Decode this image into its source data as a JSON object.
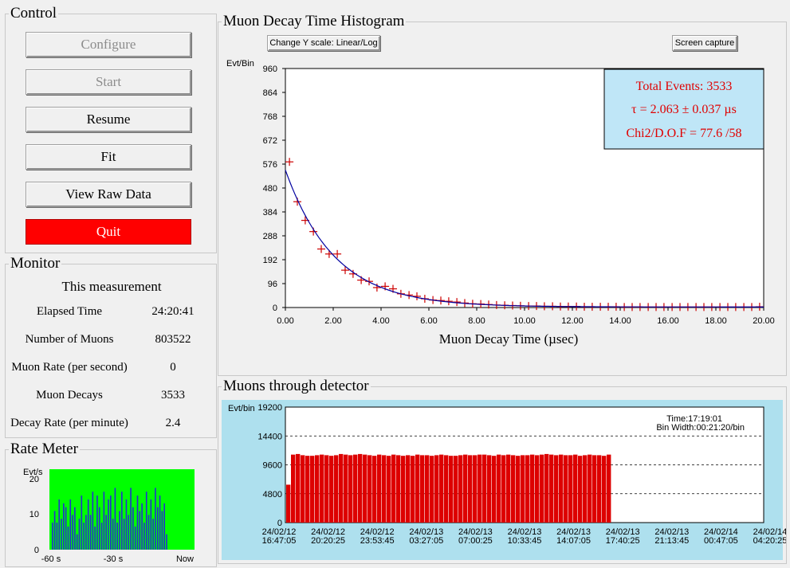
{
  "control": {
    "title": "Control",
    "buttons": {
      "configure": "Configure",
      "start": "Start",
      "resume": "Resume",
      "fit": "Fit",
      "view_raw": "View Raw Data",
      "quit": "Quit"
    },
    "quit_color": "#ff0000"
  },
  "monitor": {
    "title": "Monitor",
    "subtitle": "This measurement",
    "rows": [
      {
        "label": "Elapsed Time",
        "value": "24:20:41"
      },
      {
        "label": "Number of Muons",
        "value": "803522"
      },
      {
        "label": "Muon Rate (per second)",
        "value": "0"
      },
      {
        "label": "Muon Decays",
        "value": "3533"
      },
      {
        "label": "Decay Rate (per minute)",
        "value": "2.4"
      }
    ]
  },
  "rate_meter": {
    "title": "Rate Meter",
    "ylabel": "Evt/s",
    "yticks": [
      "20",
      "10",
      "0"
    ],
    "xticks": [
      "-60 s",
      "-30 s",
      "Now"
    ],
    "colors": {
      "background": "#00ff00",
      "bars": "#2233cc"
    }
  },
  "histogram": {
    "title": "Muon Decay Time Histogram",
    "buttons": {
      "scale": "Change Y scale: Linear/Log",
      "capture": "Screen capture"
    },
    "info": {
      "total": "Total Events: 3533",
      "tau": "τ = 2.063 ± 0.037 µs",
      "chi2": "Chi2/D.O.F = 77.6 /58"
    },
    "colors": {
      "info_bg": "#bfe6f7",
      "info_text": "#e00000",
      "points": "#cc0000",
      "fit": "#0000a0"
    }
  },
  "detector": {
    "title": "Muons through detector",
    "time": "Time:17:19:01",
    "binwidth": "Bin Width:00:21:20/bin",
    "colors": {
      "outer_bg": "#aee0ee",
      "inner_bg": "#ffffff",
      "bars": "#dd0000"
    }
  },
  "chart_data": [
    {
      "type": "scatter",
      "title": "",
      "xlabel": "Muon Decay Time (µsec)",
      "ylabel": "Evt/Bin",
      "xlim": [
        0,
        20
      ],
      "ylim": [
        0,
        960
      ],
      "xticks": [
        "0.00",
        "2.00",
        "4.00",
        "6.00",
        "8.00",
        "10.00",
        "12.00",
        "14.00",
        "16.00",
        "18.00",
        "20.00"
      ],
      "yticks": [
        "0",
        "96",
        "192",
        "288",
        "384",
        "480",
        "576",
        "672",
        "768",
        "864",
        "960"
      ],
      "grid": false,
      "x": [
        0.17,
        0.5,
        0.83,
        1.17,
        1.5,
        1.83,
        2.17,
        2.5,
        2.83,
        3.17,
        3.5,
        3.83,
        4.17,
        4.5,
        4.83,
        5.17,
        5.5,
        5.83,
        6.17,
        6.5,
        6.83,
        7.17,
        7.5,
        7.83,
        8.17,
        8.5,
        8.83,
        9.17,
        9.5,
        9.83,
        10.17,
        10.5,
        10.83,
        11.17,
        11.5,
        11.83,
        12.17,
        12.5,
        12.83,
        13.17,
        13.5,
        13.83,
        14.17,
        14.5,
        14.83,
        15.17,
        15.5,
        15.83,
        16.17,
        16.5,
        16.83,
        17.17,
        17.5,
        17.83,
        18.17,
        18.5,
        18.83,
        19.17,
        19.5,
        19.83
      ],
      "y": [
        585,
        425,
        350,
        305,
        235,
        215,
        215,
        150,
        135,
        110,
        105,
        80,
        85,
        75,
        55,
        50,
        45,
        35,
        30,
        28,
        25,
        22,
        18,
        15,
        14,
        12,
        10,
        9,
        8,
        7,
        6,
        6,
        5,
        5,
        4,
        4,
        4,
        3,
        3,
        3,
        3,
        3,
        2,
        2,
        2,
        2,
        2,
        2,
        2,
        2,
        2,
        2,
        2,
        2,
        2,
        2,
        2,
        2,
        2,
        3
      ],
      "fit": {
        "A": 550,
        "tau": 2.063
      }
    },
    {
      "type": "bar",
      "title": "",
      "ylabel": "Evt/bin",
      "ylim": [
        0,
        19200
      ],
      "yticks": [
        "0",
        "4800",
        "9600",
        "14400",
        "19200"
      ],
      "xticks": [
        [
          "24/02/12",
          "16:47:05"
        ],
        [
          "24/02/12",
          "20:20:25"
        ],
        [
          "24/02/12",
          "23:53:45"
        ],
        [
          "24/02/13",
          "03:27:05"
        ],
        [
          "24/02/13",
          "07:00:25"
        ],
        [
          "24/02/13",
          "10:33:45"
        ],
        [
          "24/02/13",
          "14:07:05"
        ],
        [
          "24/02/13",
          "17:40:25"
        ],
        [
          "24/02/13",
          "21:13:45"
        ],
        [
          "24/02/14",
          "00:47:05"
        ],
        [
          "24/02/14",
          "04:20:25"
        ]
      ],
      "values": [
        6300,
        11300,
        11400,
        11200,
        11100,
        11100,
        11200,
        11300,
        11200,
        11100,
        11200,
        11400,
        11300,
        11200,
        11300,
        11400,
        11300,
        11200,
        11100,
        11300,
        11200,
        11100,
        11300,
        11200,
        11100,
        11200,
        11100,
        11300,
        11200,
        11200,
        11100,
        11200,
        11300,
        11200,
        11100,
        11100,
        11200,
        11300,
        11200,
        11200,
        11300,
        11300,
        11200,
        11100,
        11300,
        11200,
        11300,
        11200,
        11100,
        11200,
        11200,
        11300,
        11200,
        11300,
        11400,
        11300,
        11200,
        11300,
        11200,
        11200,
        11300,
        11100,
        11200,
        11300,
        11200,
        11200,
        11100,
        11300
      ],
      "ref_lines": [
        4800,
        9600,
        14400
      ]
    },
    {
      "type": "bar",
      "title": "",
      "ylabel": "Evt/s",
      "ylim": [
        0,
        20
      ],
      "values": [
        7,
        10,
        7,
        13,
        8,
        12,
        11,
        6,
        13,
        9,
        11,
        4,
        8,
        14,
        7,
        9,
        13,
        9,
        15,
        6,
        14,
        11,
        7,
        15,
        9,
        13,
        14,
        8,
        16,
        7,
        10,
        15,
        8,
        13,
        9,
        16,
        11,
        6,
        14,
        10,
        12,
        7,
        15,
        9,
        13,
        8,
        16,
        11,
        14,
        10,
        12,
        4
      ]
    }
  ]
}
